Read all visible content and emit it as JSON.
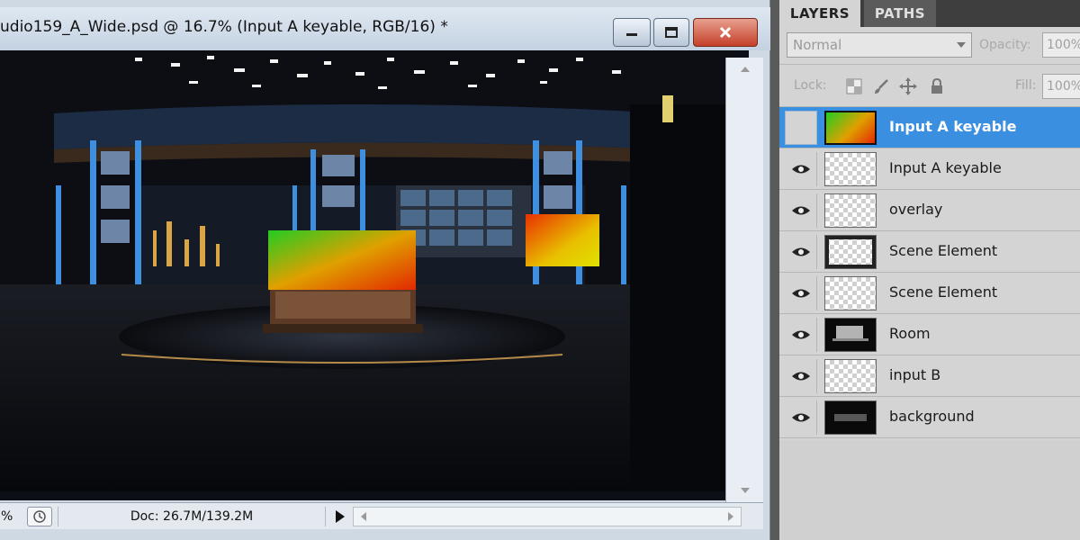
{
  "document": {
    "title": "udio159_A_Wide.psd @ 16.7% (Input A keyable, RGB/16) *",
    "zoom": "%",
    "doc_info": "Doc: 26.7M/139.2M"
  },
  "layers_panel": {
    "tabs": [
      {
        "label": "LAYERS",
        "active": true
      },
      {
        "label": "PATHS",
        "active": false
      }
    ],
    "blend_mode": "Normal",
    "opacity_label": "Opacity:",
    "opacity_value": "100%",
    "lock_label": "Lock:",
    "fill_label": "Fill:",
    "fill_value": "100%",
    "layers": [
      {
        "name": "Input A keyable",
        "visible": false,
        "selected": true,
        "thumb": "gradient"
      },
      {
        "name": "Input A keyable",
        "visible": true,
        "selected": false,
        "thumb": "checker"
      },
      {
        "name": "overlay",
        "visible": true,
        "selected": false,
        "thumb": "checker"
      },
      {
        "name": "Scene Element",
        "visible": true,
        "selected": false,
        "thumb": "checker-dark"
      },
      {
        "name": "Scene Element",
        "visible": true,
        "selected": false,
        "thumb": "checker"
      },
      {
        "name": "Room",
        "visible": true,
        "selected": false,
        "thumb": "dark"
      },
      {
        "name": "input B",
        "visible": true,
        "selected": false,
        "thumb": "checker"
      },
      {
        "name": "background",
        "visible": true,
        "selected": false,
        "thumb": "dark"
      }
    ]
  },
  "colors": {
    "selection": "#3a8fe0",
    "title_bar": "#cbd8e6",
    "panel_bg": "#d4d4d4"
  }
}
